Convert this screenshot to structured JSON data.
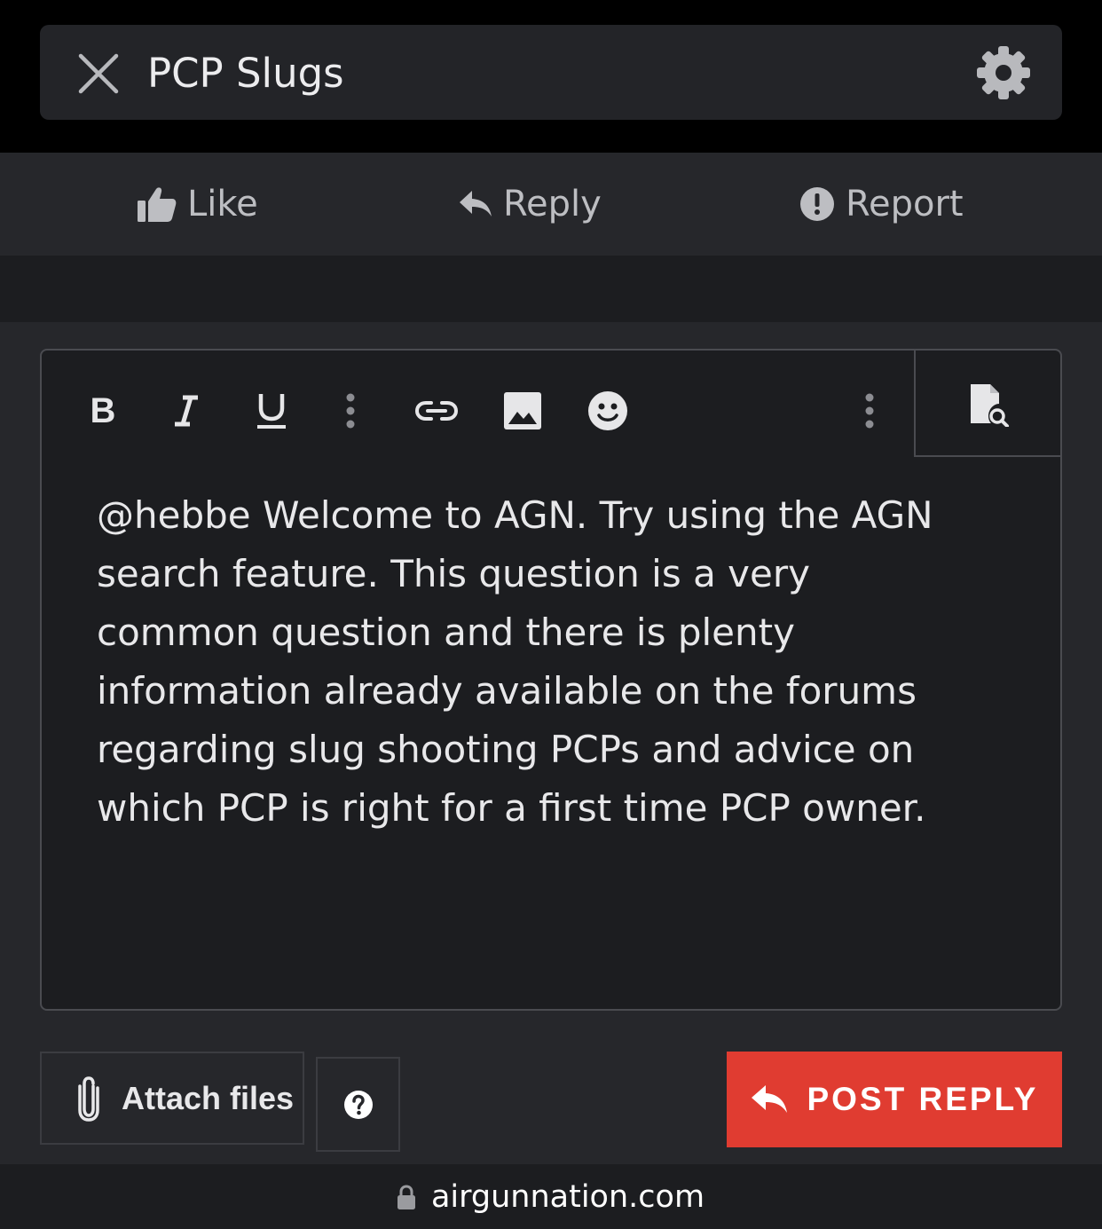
{
  "header": {
    "title": "PCP Slugs",
    "close_icon": "close-icon",
    "settings_icon": "gear-icon"
  },
  "actions": [
    {
      "label": "Like",
      "icon": "thumbs-up-icon"
    },
    {
      "label": "Reply",
      "icon": "reply-icon"
    },
    {
      "label": "Report",
      "icon": "alert-icon"
    }
  ],
  "toolbar": {
    "bold": "B",
    "buttons": [
      "bold-icon",
      "italic-icon",
      "underline-icon",
      "more-options-icon",
      "link-icon",
      "image-icon",
      "emoji-icon",
      "more-options-icon",
      "preview-icon"
    ]
  },
  "editor": {
    "text": "@hebbe Welcome to AGN. Try using the AGN\nsearch feature. This question is a very\ncommon question and there is plenty\ninformation already available on the forums\nregarding slug shooting PCPs and advice on\nwhich PCP is right for a first time PCP owner."
  },
  "footer": {
    "attach_label": "Attach files",
    "post_reply_label": "POST REPLY",
    "help_icon": "help-icon"
  },
  "browser": {
    "url": "airgunnation.com",
    "lock_icon": "lock-icon"
  },
  "colors": {
    "accent": "#e03c31",
    "background": "#26272b",
    "editor_background": "#1c1d20"
  }
}
